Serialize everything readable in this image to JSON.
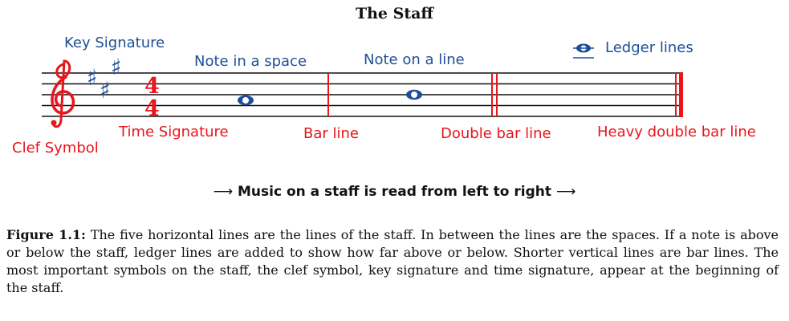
{
  "title": "The Staff",
  "labels": {
    "key_signature": "Key Signature",
    "note_space": "Note in a space",
    "note_line": "Note on a line",
    "ledger_lines": "Ledger lines",
    "clef_symbol": "Clef Symbol",
    "time_signature": "Time Signature",
    "bar_line": "Bar line",
    "double_bar_line": "Double bar line",
    "heavy_double_bar_line": "Heavy double bar line"
  },
  "time_signature": {
    "top": "4",
    "bottom": "4"
  },
  "reading_direction": "Music on a staff is read from left to right",
  "caption": {
    "label": "Figure 1.1:",
    "text": "The five horizontal lines are the lines of the staff. In between the lines are the spaces. If a note is above or below the staff, ledger lines are added to show how far above or below. Shorter vertical lines are bar lines. The most important symbols on the staff, the clef symbol, key signature and time signature, appear at the beginning of the staff."
  },
  "colors": {
    "blue": "#1f4e99",
    "red": "#e8151b",
    "black": "#111111"
  }
}
